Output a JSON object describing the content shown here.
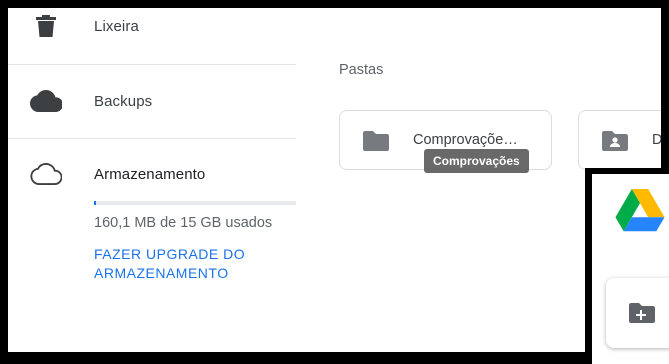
{
  "sidebar": {
    "items": [
      {
        "label": "Lixeira",
        "icon": "trash-icon"
      },
      {
        "label": "Backups",
        "icon": "cloud-filled-icon"
      },
      {
        "label": "Armazenamento",
        "icon": "cloud-outline-icon"
      }
    ],
    "storage": {
      "used_fraction": 0.01,
      "usage_text": "160,1 MB de 15 GB usados",
      "upgrade_label": "FAZER UPGRADE DO ARMAZENAMENTO"
    }
  },
  "main": {
    "section_title": "Pastas",
    "folders": [
      {
        "name": "Comprovaçõe…",
        "icon": "folder-icon"
      },
      {
        "name": "Di",
        "icon": "shared-folder-icon"
      }
    ],
    "tooltip": "Comprovações"
  },
  "overlay": {
    "logo": "google-drive-logo",
    "new_folder_icon": "new-folder-icon"
  },
  "colors": {
    "accent": "#1a73e8",
    "icon_gray": "#5f6368",
    "tooltip_bg": "#616161"
  }
}
